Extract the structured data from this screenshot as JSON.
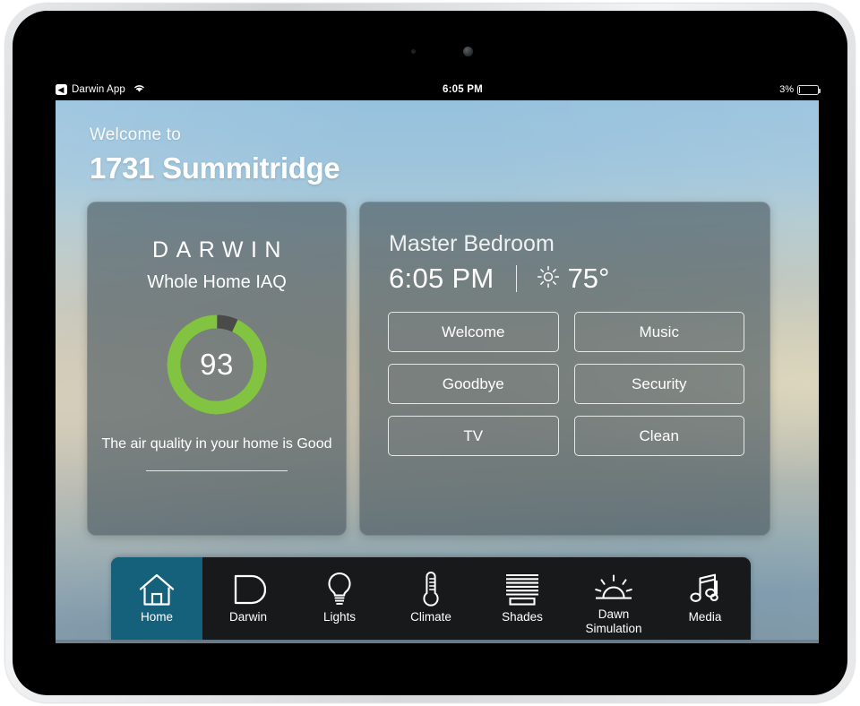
{
  "statusbar": {
    "back_label": "Darwin App",
    "back_icon": "chevron-left-icon",
    "wifi_icon": "wifi-icon",
    "time": "6:05 PM",
    "battery_percent": "3%",
    "battery_level": 3,
    "battery_icon": "battery-icon"
  },
  "header": {
    "greeting": "Welcome to",
    "home_name": "1731 Summitridge"
  },
  "iaq_card": {
    "brand": "DARWIN",
    "subtitle": "Whole Home IAQ",
    "score": "93",
    "score_value": 93,
    "gauge_max": 100,
    "gauge_color": "#82c341",
    "gauge_track_color": "#4a4a48",
    "message": "The air quality in your home is Good"
  },
  "room_card": {
    "room_name": "Master Bedroom",
    "time": "6:05 PM",
    "separator": "|",
    "weather_icon": "sun-icon",
    "temperature": "75°",
    "scenes": [
      {
        "label": "Welcome",
        "name": "scene-welcome"
      },
      {
        "label": "Music",
        "name": "scene-music"
      },
      {
        "label": "Goodbye",
        "name": "scene-goodbye"
      },
      {
        "label": "Security",
        "name": "scene-security"
      },
      {
        "label": "TV",
        "name": "scene-tv"
      },
      {
        "label": "Clean",
        "name": "scene-clean"
      }
    ]
  },
  "navbar": {
    "active_index": 0,
    "active_color": "#15607a",
    "items": [
      {
        "label": "Home",
        "icon": "home-icon",
        "name": "nav-home"
      },
      {
        "label": "Darwin",
        "icon": "darwin-d-icon",
        "name": "nav-darwin"
      },
      {
        "label": "Lights",
        "icon": "lightbulb-icon",
        "name": "nav-lights"
      },
      {
        "label": "Climate",
        "icon": "thermometer-icon",
        "name": "nav-climate"
      },
      {
        "label": "Shades",
        "icon": "blinds-icon",
        "name": "nav-shades"
      },
      {
        "label": "Dawn Simulation",
        "icon": "sunrise-icon",
        "name": "nav-dawn-simulation"
      },
      {
        "label": "Media",
        "icon": "music-notes-icon",
        "name": "nav-media"
      }
    ]
  }
}
